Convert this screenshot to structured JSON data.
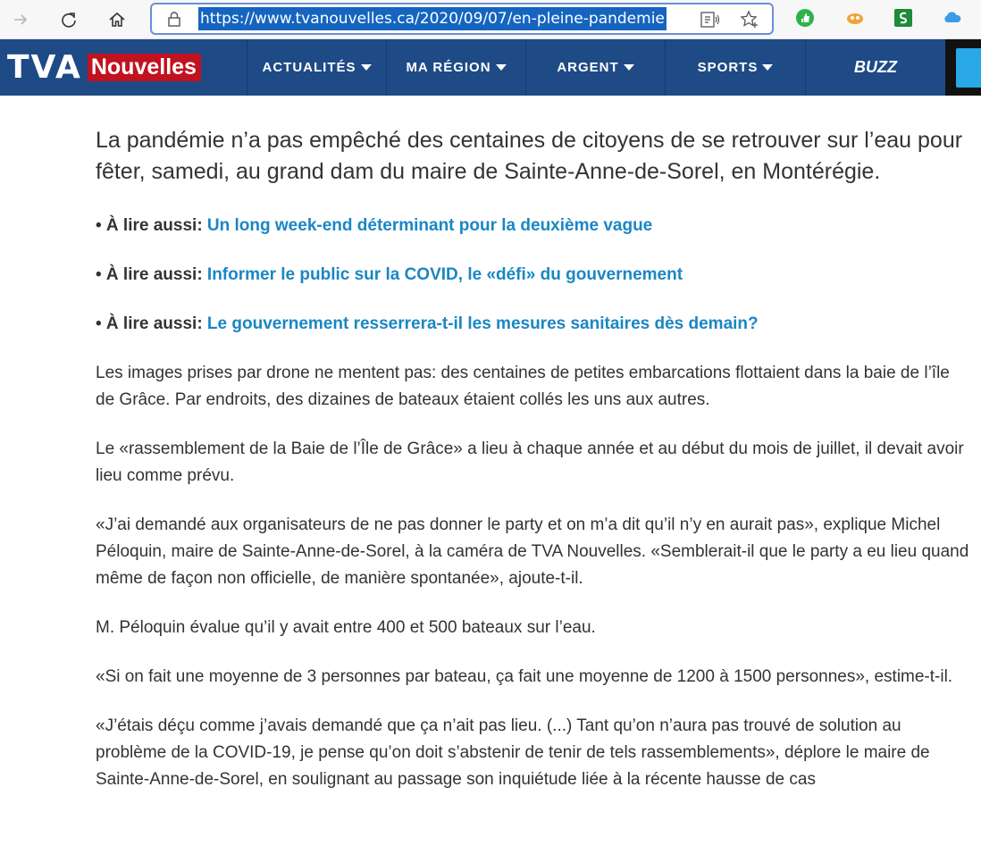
{
  "browser": {
    "url": "https://www.tvanouvelles.ca/2020/09/07/en-pleine-pandemie"
  },
  "site": {
    "logo_tva": "TVA",
    "logo_nouvelles": "Nouvelles",
    "nav": [
      {
        "label": "ACTUALITÉS"
      },
      {
        "label": "MA RÉGION"
      },
      {
        "label": "ARGENT"
      },
      {
        "label": "SPORTS"
      },
      {
        "label": "BUZZ"
      }
    ]
  },
  "article": {
    "lead": "La pandémie n’a pas empêché des centaines de citoyens de se retrouver sur l’eau pour fêter, samedi, au grand dam du maire de Sainte-Anne-de-Sorel, en Montérégie.",
    "read_also_label": "• À lire aussi:",
    "read_also": [
      "Un long week-end déterminant pour la deuxième vague",
      "Informer le public sur la COVID, le «défi» du gouvernement",
      "Le gouvernement resserrera-t-il les mesures sanitaires dès demain?"
    ],
    "paragraphs": [
      "Les images prises par drone ne mentent pas: des centaines de petites embarcations flottaient dans la baie de l’île de Grâce. Par endroits, des dizaines de bateaux étaient collés les uns aux autres.",
      "Le «rassemblement de la Baie de l’Île de Grâce» a lieu à chaque année et au début du mois de juillet, il devait avoir lieu comme prévu.",
      "«J’ai demandé aux organisateurs de ne pas donner le party et on m’a dit qu’il n’y en aurait pas», explique Michel Péloquin, maire de Sainte-Anne-de-Sorel, à la caméra de TVA Nouvelles. «Semblerait-il que le party a eu lieu quand même de façon non officielle, de manière spontanée», ajoute-t-il.",
      "M. Péloquin évalue qu’il y avait entre 400 et 500 bateaux sur l’eau.",
      "«Si on fait une moyenne de 3 personnes par bateau, ça fait une moyenne de 1200 à 1500 personnes», estime-t-il.",
      "«J’étais déçu comme j’avais demandé que ça n’ait pas lieu. (...) Tant qu’on n’aura pas trouvé de solution au problème de la COVID-19, je pense qu’on doit s’abstenir de tenir de tels rassemblements», déplore le maire de Sainte-Anne-de-Sorel, en soulignant au passage son inquiétude liée à la récente hausse de cas"
    ]
  }
}
